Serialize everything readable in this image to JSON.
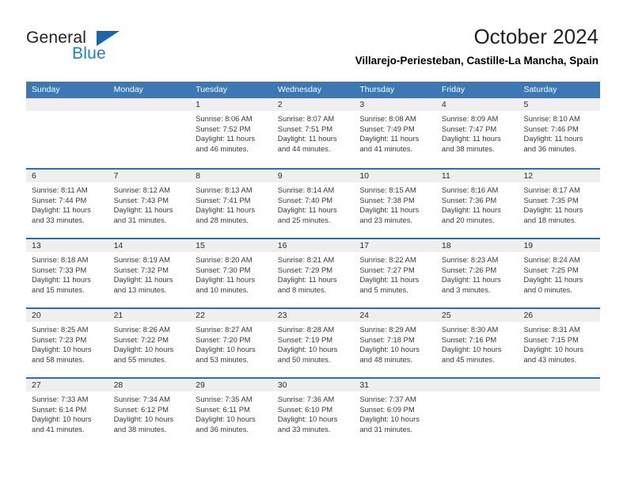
{
  "brand": {
    "name_part1": "General",
    "name_part2": "Blue",
    "triangle_color": "#1a66ad",
    "blue_color": "#1f7fd0"
  },
  "header": {
    "month_title": "October 2024",
    "location": "Villarejo-Periesteban, Castille-La Mancha, Spain"
  },
  "calendar": {
    "header_bg": "#3c78b4",
    "row_divider_color": "#2e6daf",
    "daynum_band_bg": "#efefef",
    "weekday_headers": [
      "Sunday",
      "Monday",
      "Tuesday",
      "Wednesday",
      "Thursday",
      "Friday",
      "Saturday"
    ],
    "weeks": [
      [
        {
          "day": "",
          "sunrise": "",
          "sunset": "",
          "daylight1": "",
          "daylight2": ""
        },
        {
          "day": "",
          "sunrise": "",
          "sunset": "",
          "daylight1": "",
          "daylight2": ""
        },
        {
          "day": "1",
          "sunrise": "Sunrise: 8:06 AM",
          "sunset": "Sunset: 7:52 PM",
          "daylight1": "Daylight: 11 hours",
          "daylight2": "and 46 minutes."
        },
        {
          "day": "2",
          "sunrise": "Sunrise: 8:07 AM",
          "sunset": "Sunset: 7:51 PM",
          "daylight1": "Daylight: 11 hours",
          "daylight2": "and 44 minutes."
        },
        {
          "day": "3",
          "sunrise": "Sunrise: 8:08 AM",
          "sunset": "Sunset: 7:49 PM",
          "daylight1": "Daylight: 11 hours",
          "daylight2": "and 41 minutes."
        },
        {
          "day": "4",
          "sunrise": "Sunrise: 8:09 AM",
          "sunset": "Sunset: 7:47 PM",
          "daylight1": "Daylight: 11 hours",
          "daylight2": "and 38 minutes."
        },
        {
          "day": "5",
          "sunrise": "Sunrise: 8:10 AM",
          "sunset": "Sunset: 7:46 PM",
          "daylight1": "Daylight: 11 hours",
          "daylight2": "and 36 minutes."
        }
      ],
      [
        {
          "day": "6",
          "sunrise": "Sunrise: 8:11 AM",
          "sunset": "Sunset: 7:44 PM",
          "daylight1": "Daylight: 11 hours",
          "daylight2": "and 33 minutes."
        },
        {
          "day": "7",
          "sunrise": "Sunrise: 8:12 AM",
          "sunset": "Sunset: 7:43 PM",
          "daylight1": "Daylight: 11 hours",
          "daylight2": "and 31 minutes."
        },
        {
          "day": "8",
          "sunrise": "Sunrise: 8:13 AM",
          "sunset": "Sunset: 7:41 PM",
          "daylight1": "Daylight: 11 hours",
          "daylight2": "and 28 minutes."
        },
        {
          "day": "9",
          "sunrise": "Sunrise: 8:14 AM",
          "sunset": "Sunset: 7:40 PM",
          "daylight1": "Daylight: 11 hours",
          "daylight2": "and 25 minutes."
        },
        {
          "day": "10",
          "sunrise": "Sunrise: 8:15 AM",
          "sunset": "Sunset: 7:38 PM",
          "daylight1": "Daylight: 11 hours",
          "daylight2": "and 23 minutes."
        },
        {
          "day": "11",
          "sunrise": "Sunrise: 8:16 AM",
          "sunset": "Sunset: 7:36 PM",
          "daylight1": "Daylight: 11 hours",
          "daylight2": "and 20 minutes."
        },
        {
          "day": "12",
          "sunrise": "Sunrise: 8:17 AM",
          "sunset": "Sunset: 7:35 PM",
          "daylight1": "Daylight: 11 hours",
          "daylight2": "and 18 minutes."
        }
      ],
      [
        {
          "day": "13",
          "sunrise": "Sunrise: 8:18 AM",
          "sunset": "Sunset: 7:33 PM",
          "daylight1": "Daylight: 11 hours",
          "daylight2": "and 15 minutes."
        },
        {
          "day": "14",
          "sunrise": "Sunrise: 8:19 AM",
          "sunset": "Sunset: 7:32 PM",
          "daylight1": "Daylight: 11 hours",
          "daylight2": "and 13 minutes."
        },
        {
          "day": "15",
          "sunrise": "Sunrise: 8:20 AM",
          "sunset": "Sunset: 7:30 PM",
          "daylight1": "Daylight: 11 hours",
          "daylight2": "and 10 minutes."
        },
        {
          "day": "16",
          "sunrise": "Sunrise: 8:21 AM",
          "sunset": "Sunset: 7:29 PM",
          "daylight1": "Daylight: 11 hours",
          "daylight2": "and 8 minutes."
        },
        {
          "day": "17",
          "sunrise": "Sunrise: 8:22 AM",
          "sunset": "Sunset: 7:27 PM",
          "daylight1": "Daylight: 11 hours",
          "daylight2": "and 5 minutes."
        },
        {
          "day": "18",
          "sunrise": "Sunrise: 8:23 AM",
          "sunset": "Sunset: 7:26 PM",
          "daylight1": "Daylight: 11 hours",
          "daylight2": "and 3 minutes."
        },
        {
          "day": "19",
          "sunrise": "Sunrise: 8:24 AM",
          "sunset": "Sunset: 7:25 PM",
          "daylight1": "Daylight: 11 hours",
          "daylight2": "and 0 minutes."
        }
      ],
      [
        {
          "day": "20",
          "sunrise": "Sunrise: 8:25 AM",
          "sunset": "Sunset: 7:23 PM",
          "daylight1": "Daylight: 10 hours",
          "daylight2": "and 58 minutes."
        },
        {
          "day": "21",
          "sunrise": "Sunrise: 8:26 AM",
          "sunset": "Sunset: 7:22 PM",
          "daylight1": "Daylight: 10 hours",
          "daylight2": "and 55 minutes."
        },
        {
          "day": "22",
          "sunrise": "Sunrise: 8:27 AM",
          "sunset": "Sunset: 7:20 PM",
          "daylight1": "Daylight: 10 hours",
          "daylight2": "and 53 minutes."
        },
        {
          "day": "23",
          "sunrise": "Sunrise: 8:28 AM",
          "sunset": "Sunset: 7:19 PM",
          "daylight1": "Daylight: 10 hours",
          "daylight2": "and 50 minutes."
        },
        {
          "day": "24",
          "sunrise": "Sunrise: 8:29 AM",
          "sunset": "Sunset: 7:18 PM",
          "daylight1": "Daylight: 10 hours",
          "daylight2": "and 48 minutes."
        },
        {
          "day": "25",
          "sunrise": "Sunrise: 8:30 AM",
          "sunset": "Sunset: 7:16 PM",
          "daylight1": "Daylight: 10 hours",
          "daylight2": "and 45 minutes."
        },
        {
          "day": "26",
          "sunrise": "Sunrise: 8:31 AM",
          "sunset": "Sunset: 7:15 PM",
          "daylight1": "Daylight: 10 hours",
          "daylight2": "and 43 minutes."
        }
      ],
      [
        {
          "day": "27",
          "sunrise": "Sunrise: 7:33 AM",
          "sunset": "Sunset: 6:14 PM",
          "daylight1": "Daylight: 10 hours",
          "daylight2": "and 41 minutes."
        },
        {
          "day": "28",
          "sunrise": "Sunrise: 7:34 AM",
          "sunset": "Sunset: 6:12 PM",
          "daylight1": "Daylight: 10 hours",
          "daylight2": "and 38 minutes."
        },
        {
          "day": "29",
          "sunrise": "Sunrise: 7:35 AM",
          "sunset": "Sunset: 6:11 PM",
          "daylight1": "Daylight: 10 hours",
          "daylight2": "and 36 minutes."
        },
        {
          "day": "30",
          "sunrise": "Sunrise: 7:36 AM",
          "sunset": "Sunset: 6:10 PM",
          "daylight1": "Daylight: 10 hours",
          "daylight2": "and 33 minutes."
        },
        {
          "day": "31",
          "sunrise": "Sunrise: 7:37 AM",
          "sunset": "Sunset: 6:09 PM",
          "daylight1": "Daylight: 10 hours",
          "daylight2": "and 31 minutes."
        },
        {
          "day": "",
          "sunrise": "",
          "sunset": "",
          "daylight1": "",
          "daylight2": ""
        },
        {
          "day": "",
          "sunrise": "",
          "sunset": "",
          "daylight1": "",
          "daylight2": ""
        }
      ]
    ]
  }
}
